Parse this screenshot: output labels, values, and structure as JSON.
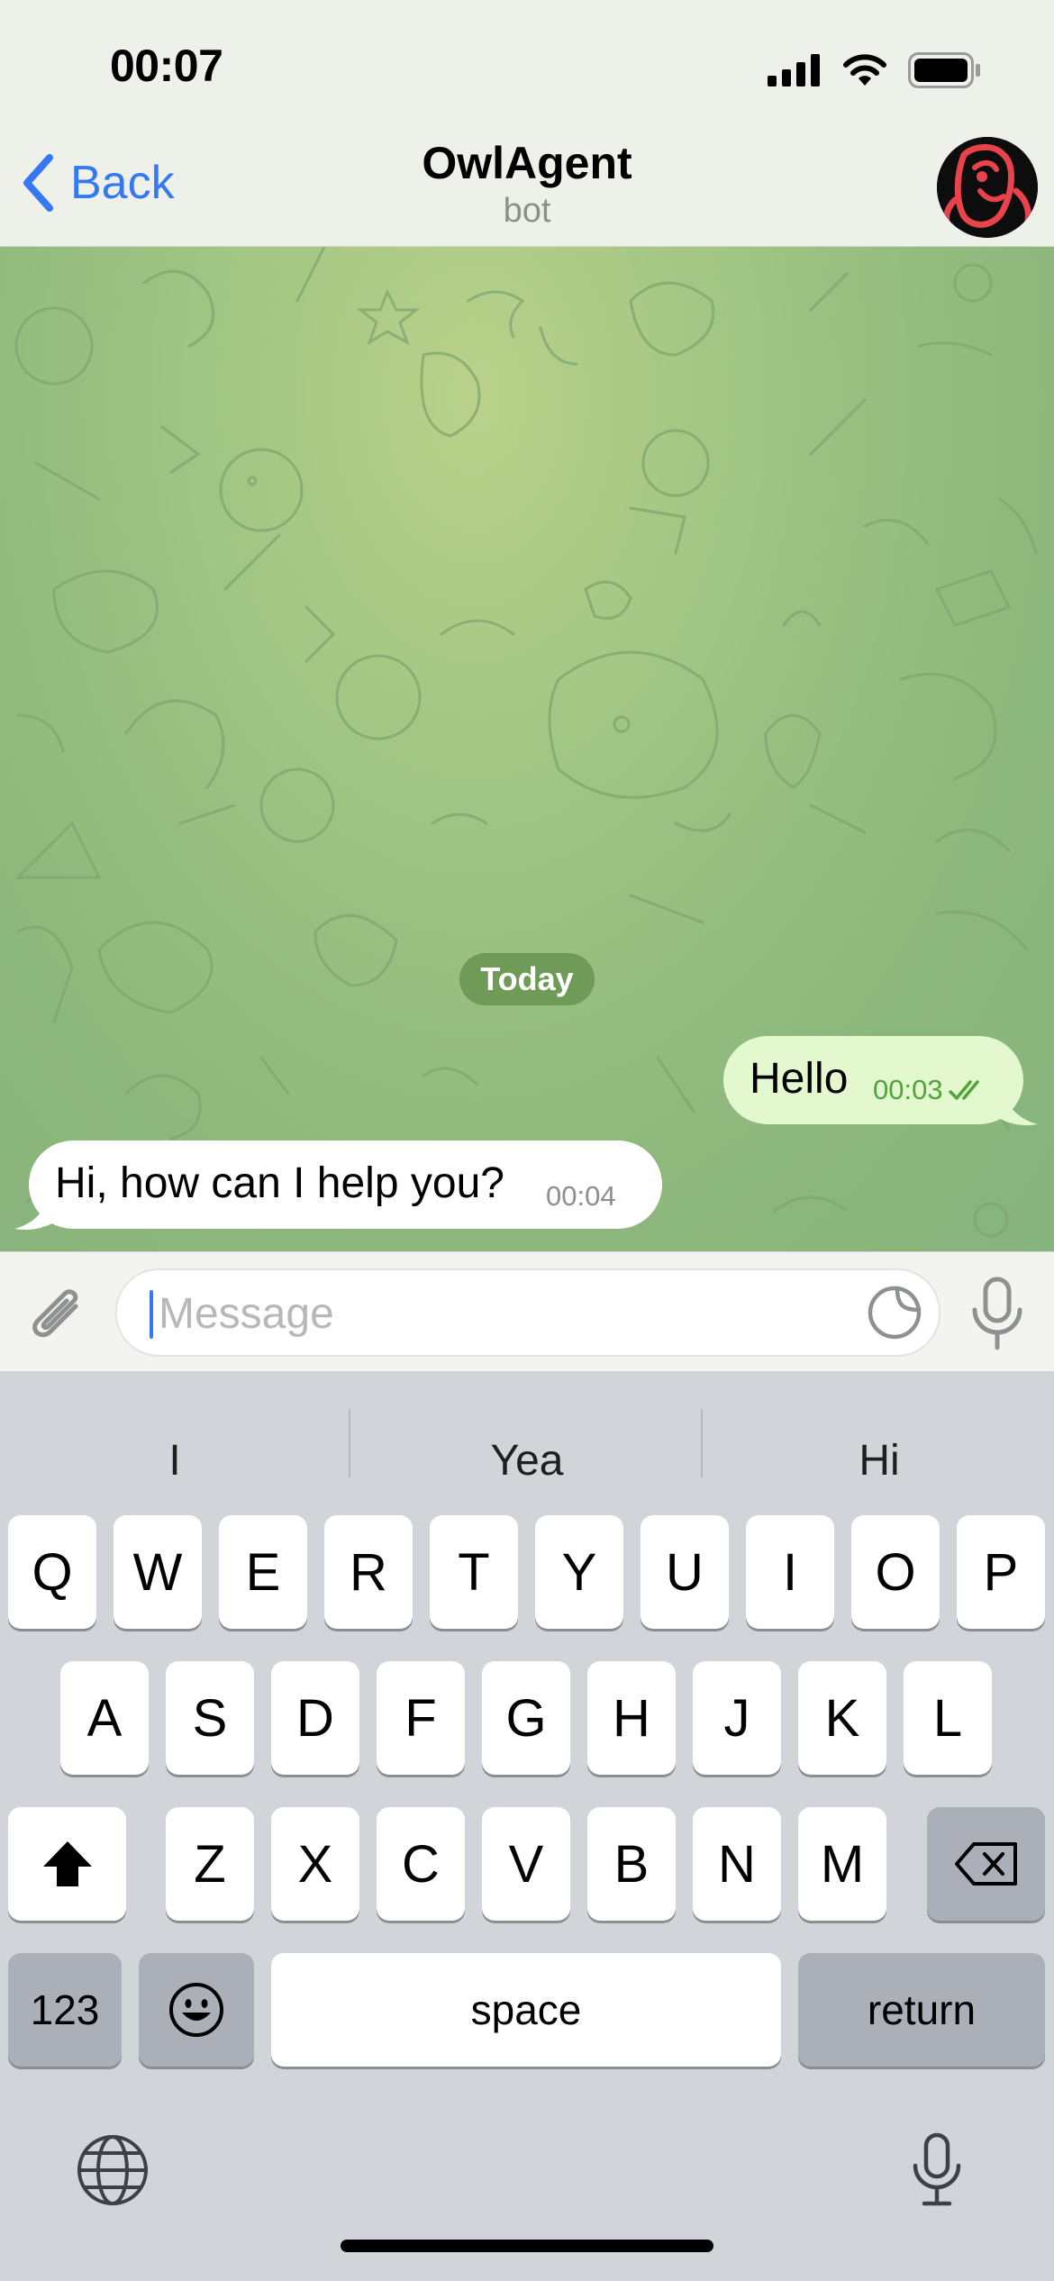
{
  "status_bar": {
    "time": "00:07"
  },
  "nav": {
    "back_label": "Back",
    "title": "OwlAgent",
    "subtitle": "bot"
  },
  "chat": {
    "date_label": "Today",
    "messages": [
      {
        "direction": "outgoing",
        "text": "Hello",
        "time": "00:03",
        "status": "read"
      },
      {
        "direction": "incoming",
        "text": "Hi, how can I help you?",
        "time": "00:04"
      }
    ]
  },
  "input": {
    "placeholder": "Message",
    "value": ""
  },
  "keyboard": {
    "suggestions": [
      "I",
      "Yea",
      "Hi"
    ],
    "row1": [
      "Q",
      "W",
      "E",
      "R",
      "T",
      "Y",
      "U",
      "I",
      "O",
      "P"
    ],
    "row2": [
      "A",
      "S",
      "D",
      "F",
      "G",
      "H",
      "J",
      "K",
      "L"
    ],
    "row3": [
      "Z",
      "X",
      "C",
      "V",
      "B",
      "N",
      "M"
    ],
    "numbers_label": "123",
    "space_label": "space",
    "return_label": "return"
  },
  "icons": {
    "back": "chevron-left-icon",
    "attach": "paperclip-icon",
    "sticker": "sticker-icon",
    "mic": "microphone-icon",
    "shift": "shift-icon",
    "delete": "backspace-icon",
    "emoji": "emoji-icon",
    "globe": "globe-icon",
    "dictation": "microphone-icon"
  },
  "colors": {
    "accent": "#3478f6",
    "outgoing_bubble": "#e4f8cf",
    "incoming_bubble": "#ffffff",
    "read_check": "#4fa43a",
    "avatar_mark": "#e8434b"
  }
}
